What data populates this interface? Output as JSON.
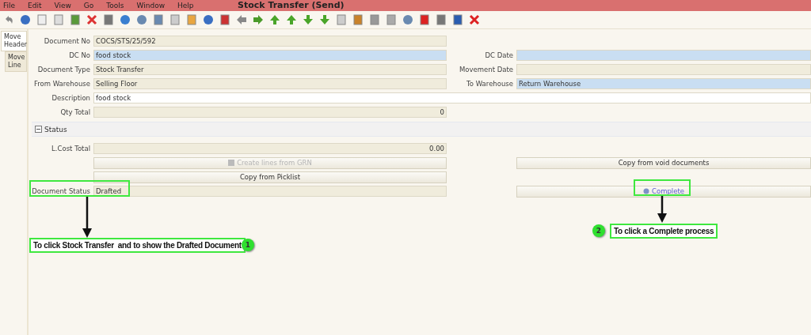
{
  "menu": [
    "File",
    "Edit",
    "View",
    "Go",
    "Tools",
    "Window",
    "Help"
  ],
  "window": {
    "title": "Stock Transfer (Send)"
  },
  "tabs": [
    {
      "label": "Move Header",
      "selected": true
    },
    {
      "label": "Move Line",
      "selected": false
    }
  ],
  "header_rows": [
    {
      "left": {
        "label": "Document No",
        "value": "COCS/STS/25/592",
        "kind": "readonly"
      }
    },
    {
      "left": {
        "label": "DC No",
        "value": "food stock",
        "kind": "mandatory"
      },
      "right": {
        "label": "DC Date",
        "kind": "mandatory"
      }
    },
    {
      "left": {
        "label": "Document Type",
        "value": "Stock Transfer",
        "kind": "readonly"
      },
      "right": {
        "label": "Movement Date",
        "kind": "readonly"
      }
    },
    {
      "left": {
        "label": "From Warehouse",
        "value": "Selling Floor",
        "kind": "readonly"
      },
      "right": {
        "label": "To Warehouse",
        "value": "Return Warehouse",
        "kind": "mandatory"
      }
    },
    {
      "left": {
        "label": "Description",
        "value": "food stock",
        "kind": "editable",
        "wide": true
      }
    },
    {
      "left": {
        "label": "Qty Total",
        "value": "0",
        "kind": "readonly",
        "numeric": true
      }
    }
  ],
  "status_section": {
    "title": "Status",
    "expanded": true,
    "rows": [
      {
        "left": {
          "kind": "readonly",
          "label": "L.Cost Total",
          "value": "0.00",
          "numeric": true
        }
      },
      {
        "left": {
          "kind": "button",
          "label": "Create lines from GRN",
          "disabled": true
        },
        "right": {
          "kind": "button",
          "label": "Copy from void documents",
          "disabled": false
        }
      },
      {
        "left": {
          "kind": "button",
          "label": "Copy from Picklist",
          "disabled": false
        }
      },
      {
        "left": {
          "kind": "readonly",
          "label": "Document Status",
          "value": "Drafted"
        },
        "right": {
          "kind": "process",
          "label": "Complete",
          "disabled": false
        }
      }
    ]
  },
  "callouts": [
    {
      "number": "1",
      "text": "To click Stock Transfer  and to show the Drafted Document"
    },
    {
      "number": "2",
      "text": "To click a Complete process"
    }
  ]
}
